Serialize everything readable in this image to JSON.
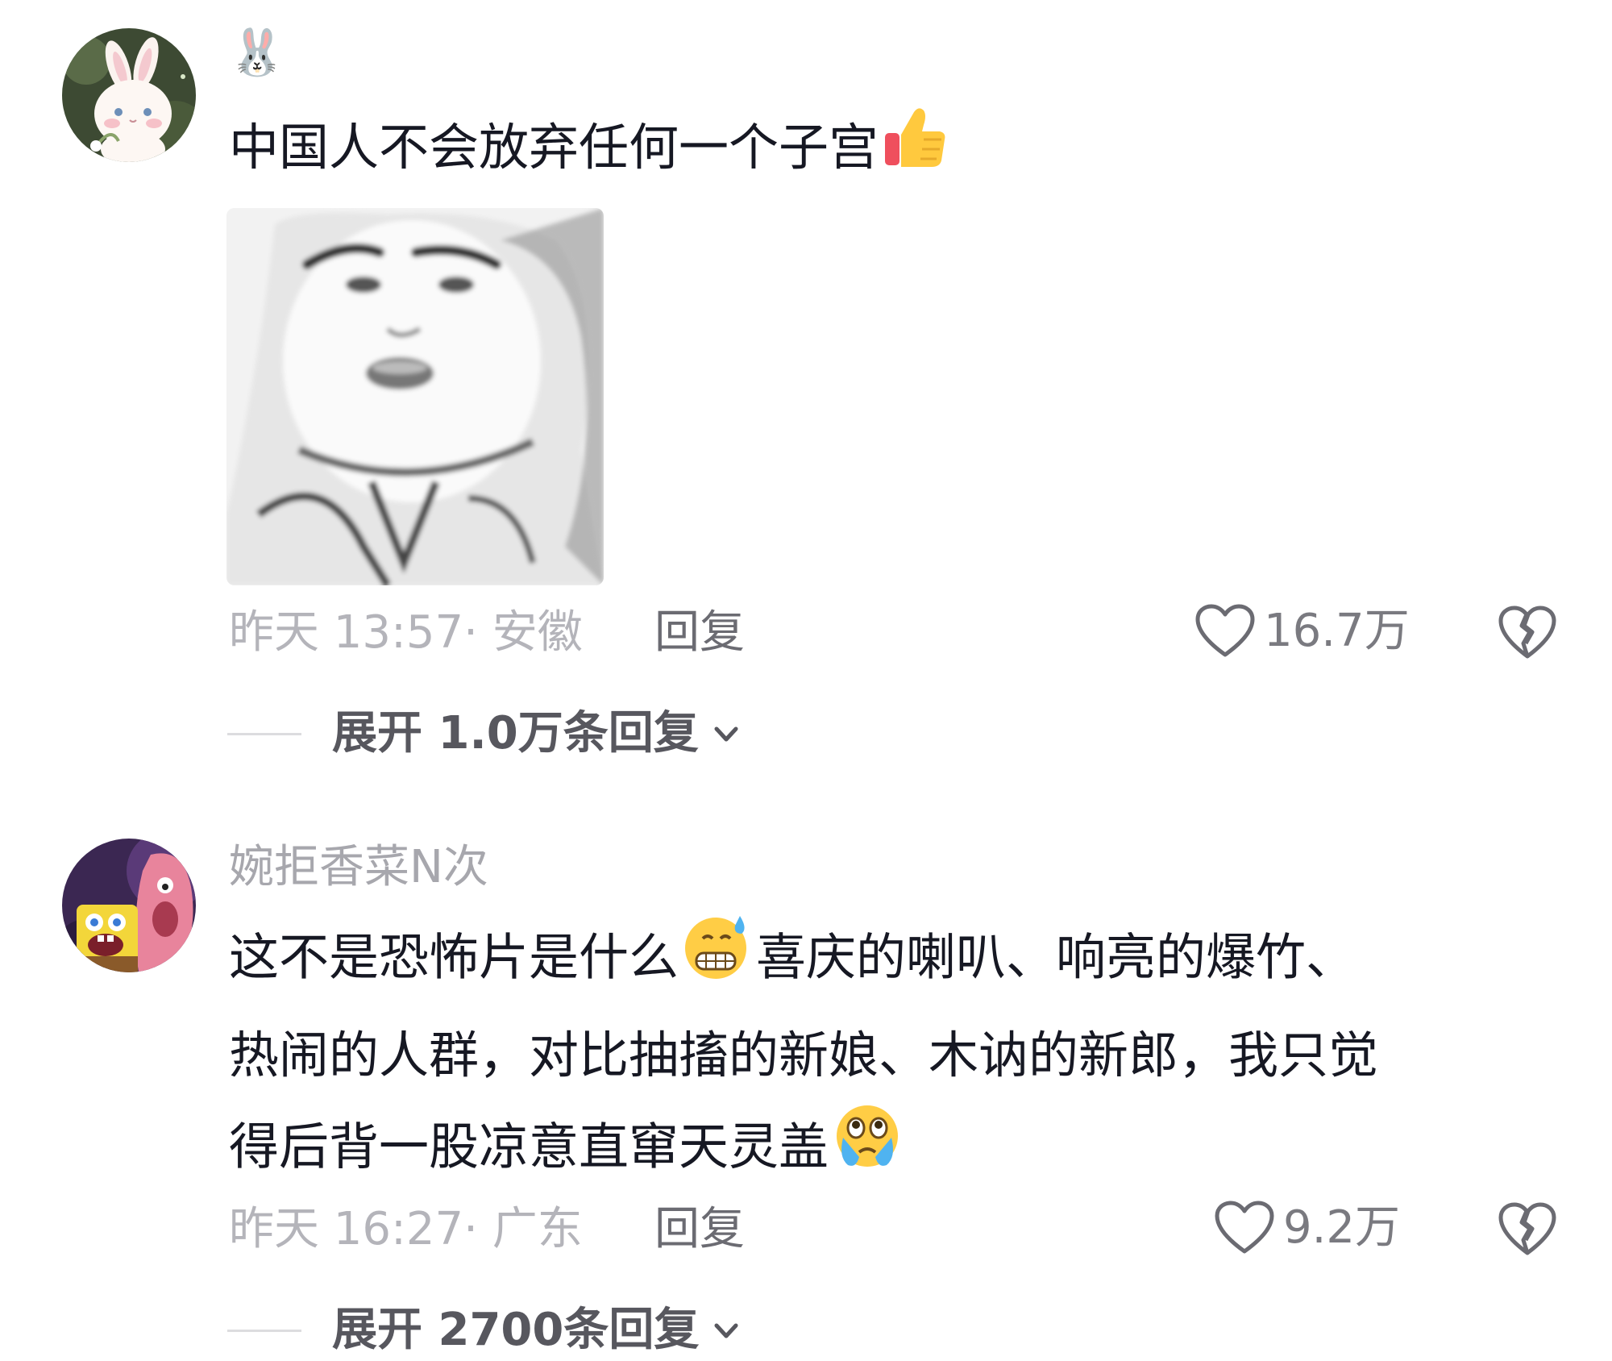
{
  "comments": [
    {
      "username": "🐰",
      "text_lines": [
        "中国人不会放弃任何一个子宫"
      ],
      "trailing_emoji": "thumbs-up",
      "has_sticker": true,
      "time": "昨天 13:57",
      "location": "安徽",
      "meta": "昨天 13:57· 安徽",
      "reply_label": "回复",
      "likes": "16.7万",
      "expand_label": "展开 1.0万条回复"
    },
    {
      "username": "婉拒香菜N次",
      "text_lines": [
        "这不是恐怖片是什么",
        "喜庆的喇叭、响亮的爆竹、",
        "热闹的人群，对比抽搐的新娘、木讷的新郎，我只觉",
        "得后背一股凉意直窜天灵盖"
      ],
      "meta": "昨天 16:27· 广东",
      "reply_label": "回复",
      "likes": "9.2万",
      "expand_label": "展开 2700条回复"
    }
  ],
  "icons": {
    "like": "heart-outline-icon",
    "dislike": "broken-heart-icon",
    "expand": "chevron-down-icon"
  },
  "colors": {
    "text": "#161823",
    "meta": "#b4b4ba",
    "secondary": "#6b6b72"
  }
}
